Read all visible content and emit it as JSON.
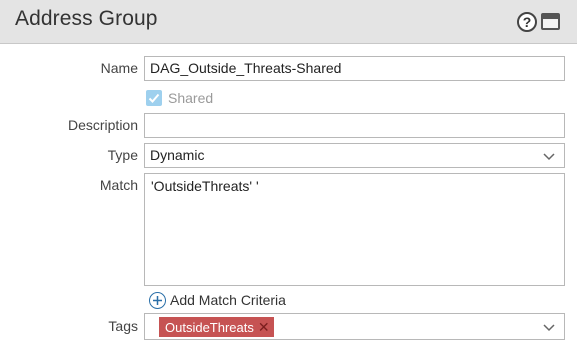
{
  "dialog": {
    "title": "Address Group",
    "help_icon": "help-icon",
    "window_icon": "window-icon"
  },
  "form": {
    "name": {
      "label": "Name",
      "value": "DAG_Outside_Threats-Shared"
    },
    "shared": {
      "label": "Shared",
      "checked": true,
      "disabled": true
    },
    "description": {
      "label": "Description",
      "value": ""
    },
    "type": {
      "label": "Type",
      "value": "Dynamic"
    },
    "match": {
      "label": "Match",
      "value": "'OutsideThreats'  '"
    },
    "add_match_criteria": {
      "label": "Add Match Criteria"
    },
    "tags": {
      "label": "Tags",
      "items": [
        {
          "label": "OutsideThreats",
          "color": "#c65353"
        }
      ]
    }
  },
  "colors": {
    "header_bg": "#e4e4e4",
    "tag_bg": "#c65353",
    "checkbox_bg": "#9ed0ee",
    "accent": "#2a6fa8"
  }
}
